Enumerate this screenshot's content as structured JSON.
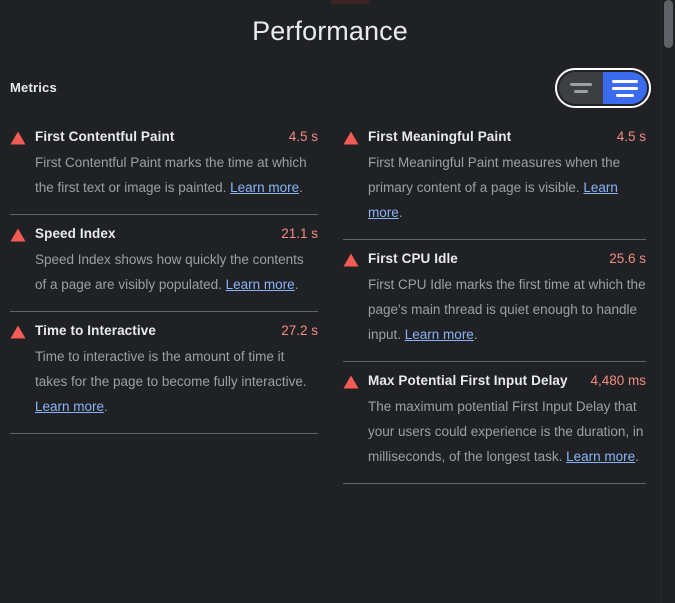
{
  "page": {
    "title": "Performance",
    "top_sliver_color": "#3a2424",
    "background_color": "#202124"
  },
  "section": {
    "title": "Metrics",
    "toggle": {
      "name": "view-mode-toggle",
      "left_label": "",
      "right_label": "",
      "active": "right",
      "inactive_color": "#3c4043",
      "active_color": "#3b6cf0"
    }
  },
  "colors": {
    "warning": "#f28b82",
    "warning_icon": "#f25c54",
    "link": "#8ab4f8",
    "text_primary": "#e8eaed",
    "text_secondary": "#9aa0a6",
    "divider": "#5f6368"
  },
  "learn_more_label": "Learn more",
  "columns": {
    "left": [
      {
        "icon": "warning-triangle-icon",
        "name": "First Contentful Paint",
        "value": "4.5 s",
        "desc_before": "First Contentful Paint marks the time at which the first text or image is painted. ",
        "desc_after": "."
      },
      {
        "icon": "warning-triangle-icon",
        "name": "Speed Index",
        "value": "21.1 s",
        "desc_before": "Speed Index shows how quickly the contents of a page are visibly populated. ",
        "desc_after": "."
      },
      {
        "icon": "warning-triangle-icon",
        "name": "Time to Interactive",
        "value": "27.2 s",
        "desc_before": "Time to interactive is the amount of time it takes for the page to become fully interactive. ",
        "desc_after": "."
      }
    ],
    "right": [
      {
        "icon": "warning-triangle-icon",
        "name": "First Meaningful Paint",
        "value": "4.5 s",
        "desc_before": "First Meaningful Paint measures when the primary content of a page is visible. ",
        "desc_after": "."
      },
      {
        "icon": "warning-triangle-icon",
        "name": "First CPU Idle",
        "value": "25.6 s",
        "desc_before": "First CPU Idle marks the first time at which the page's main thread is quiet enough to handle input. ",
        "desc_after": "."
      },
      {
        "icon": "warning-triangle-icon",
        "name": "Max Potential First Input Delay",
        "value": "4,480 ms",
        "desc_before": "The maximum potential First Input Delay that your users could experience is the duration, in milliseconds, of the longest task. ",
        "desc_after": "."
      }
    ]
  },
  "scrollbar": {
    "thumb_color": "#5f6368",
    "position": "top"
  }
}
